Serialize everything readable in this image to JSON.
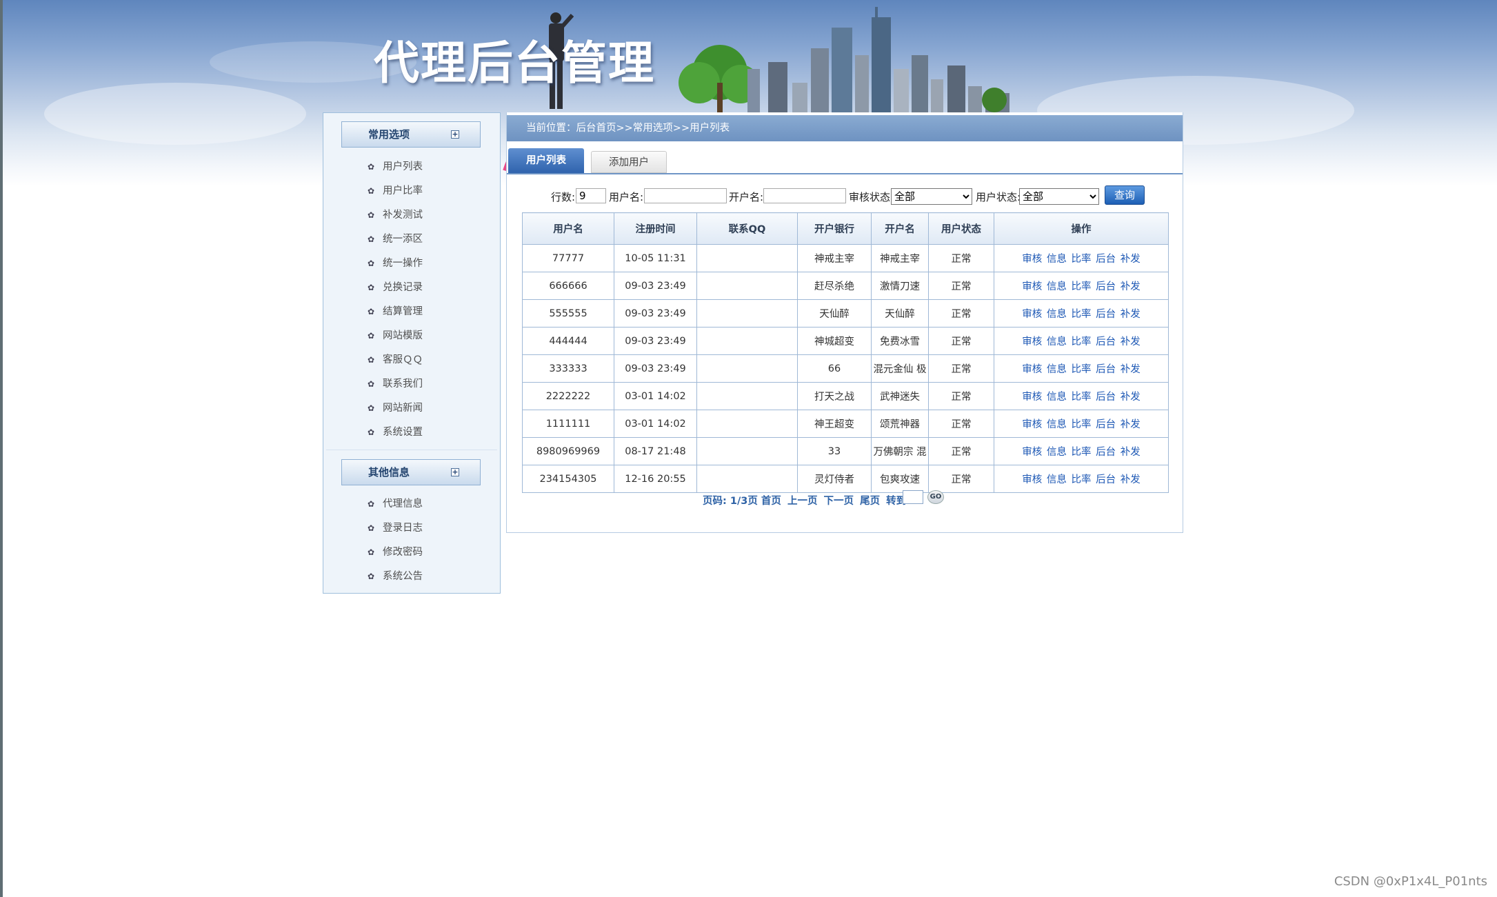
{
  "banner": {
    "title": "代理后台管理"
  },
  "sidebar": {
    "sections": [
      {
        "title": "常用选项",
        "toggle": "+",
        "items": [
          "用户列表",
          "用户比率",
          "补发测试",
          "统一添区",
          "统一操作",
          "兑换记录",
          "结算管理",
          "网站模版",
          "客服ＱＱ",
          "联系我们",
          "网站新闻",
          "系统设置"
        ]
      },
      {
        "title": "其他信息",
        "toggle": "+",
        "items": [
          "代理信息",
          "登录日志",
          "修改密码",
          "系统公告"
        ]
      }
    ],
    "icon": "gear-icon"
  },
  "breadcrumb": "当前位置：后台首页>>常用选项>>用户列表",
  "tabs": [
    {
      "label": "用户列表",
      "active": true
    },
    {
      "label": "添加用户",
      "active": false
    }
  ],
  "search": {
    "rows_label": "行数:",
    "rows_value": "9",
    "username_label": "用户名:",
    "username_value": "",
    "holder_label": "开户名:",
    "holder_value": "",
    "audit_label": "审核状态:",
    "audit_selected": "全部",
    "status_label": "用户状态:",
    "status_selected": "全部",
    "query_button": "查询"
  },
  "table": {
    "headers": [
      "用户名",
      "注册时间",
      "联系QQ",
      "开户银行",
      "开户名",
      "用户状态",
      "操作"
    ],
    "rows": [
      [
        "77777",
        "10-05 11:31",
        "",
        "神戒主宰",
        "神戒主宰",
        "正常"
      ],
      [
        "666666",
        "09-03 23:49",
        "",
        "赶尽杀绝",
        "激情刀速",
        "正常"
      ],
      [
        "555555",
        "09-03 23:49",
        "",
        "天仙醉",
        "天仙醉",
        "正常"
      ],
      [
        "444444",
        "09-03 23:49",
        "",
        "神城超变",
        "免费冰雪",
        "正常"
      ],
      [
        "333333",
        "09-03 23:49",
        "",
        "66",
        "混元金仙 极",
        "正常"
      ],
      [
        "2222222",
        "03-01 14:02",
        "",
        "打天之战",
        "武神迷失",
        "正常"
      ],
      [
        "1111111",
        "03-01 14:02",
        "",
        "神王超变",
        "颂荒神器",
        "正常"
      ],
      [
        "8980969969",
        "08-17 21:48",
        "",
        "33",
        "万佛朝宗 混",
        "正常"
      ],
      [
        "234154305",
        "12-16 20:55",
        "",
        "灵灯侍者",
        "包爽攻速",
        "正常"
      ]
    ],
    "actions": [
      "审核",
      "信息",
      "比率",
      "后台",
      "补发"
    ]
  },
  "pager": {
    "label": "页码:",
    "info": "1/3页",
    "first": "首页",
    "prev": "上一页",
    "next": "下一页",
    "last": "尾页",
    "jump_label": "转到:",
    "go": "GO"
  },
  "watermark": "CSDN @0xP1x4L_P01nts"
}
